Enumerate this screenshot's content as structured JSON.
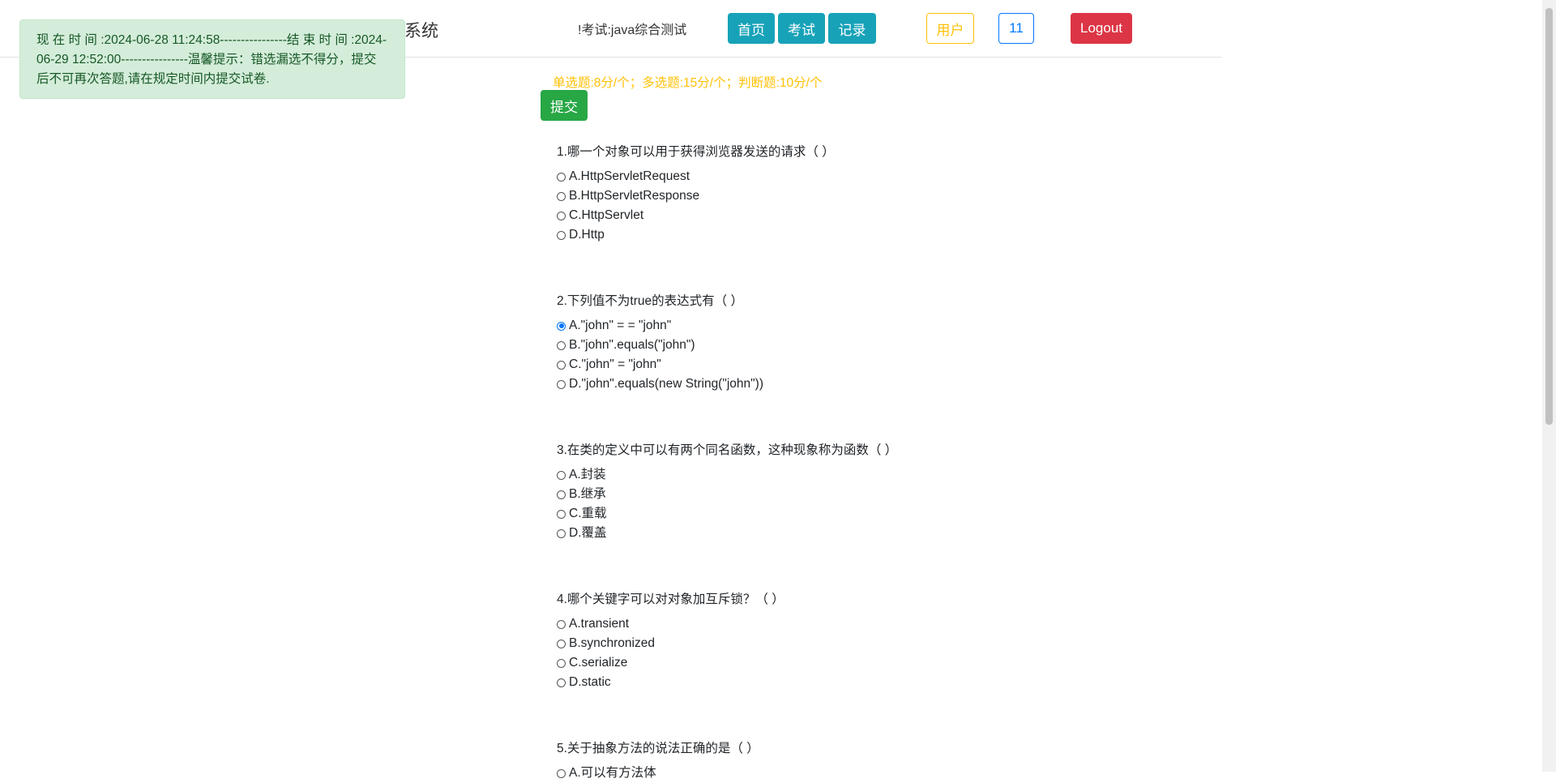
{
  "header": {
    "brand": "系统",
    "exam_title": "!考试:java综合测试",
    "nav": {
      "home": "首页",
      "exam": "考试",
      "record": "记录",
      "user": "用户",
      "user_id": "11",
      "logout": "Logout"
    }
  },
  "alert": {
    "text": "现 在 时 间 :2024-06-28 11:24:58----------------结 束 时 间 :2024-06-29 12:52:00----------------温馨提示：错选漏选不得分，提交后不可再次答题,请在规定时间内提交试卷."
  },
  "score_rule": "单选题:8分/个；多选题:15分/个；判断题:10分/个",
  "submit_label": "提交",
  "questions": [
    {
      "title": "1.哪一个对象可以用于获得浏览器发送的请求（ ）",
      "options": [
        "A.HttpServletRequest",
        "B.HttpServletResponse",
        "C.HttpServlet",
        "D.Http"
      ],
      "selected": null
    },
    {
      "title": "2.下列值不为true的表达式有（ ）",
      "options": [
        "A.\"john\" = = \"john\"",
        "B.\"john\".equals(\"john\")",
        "C.\"john\" = \"john\"",
        "D.\"john\".equals(new String(\"john\"))"
      ],
      "selected": 0
    },
    {
      "title": "3.在类的定义中可以有两个同名函数，这种现象称为函数（ ）",
      "options": [
        "A.封装",
        "B.继承",
        "C.重载",
        "D.覆盖"
      ],
      "selected": null
    },
    {
      "title": "4.哪个关键字可以对对象加互斥锁？（ ）",
      "options": [
        "A.transient",
        "B.synchronized",
        "C.serialize",
        "D.static"
      ],
      "selected": null
    },
    {
      "title": "5.关于抽象方法的说法正确的是（ ）",
      "options": [
        "A.可以有方法体"
      ],
      "selected": null
    }
  ]
}
